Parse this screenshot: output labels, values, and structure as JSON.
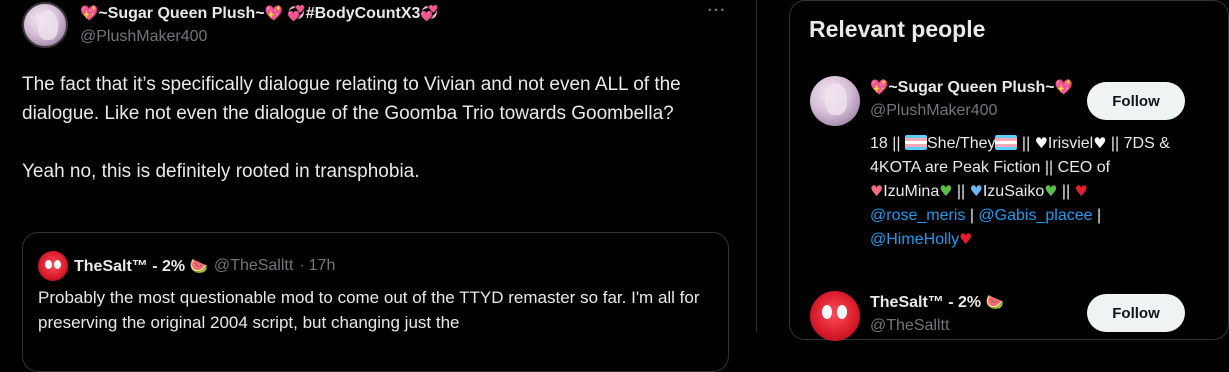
{
  "post": {
    "display_name": "~Sugar Queen Plush~",
    "display_name_suffix": "#BodyCountX3",
    "handle": "@PlushMaker400",
    "more_label": "···",
    "text": "The fact that it’s specifically dialogue relating to Vivian and not even ALL of the dialogue. Like not even the dialogue of the Goomba Trio towards Goombella?\n\nYeah no, this is definitely rooted in transphobia."
  },
  "quote": {
    "name": "TheSalt™ - 2%",
    "handle": "@TheSalltt",
    "separator": "·",
    "time": "17h",
    "text": "Probably the most questionable mod to come out of the TTYD remaster so far. I'm all for preserving the original 2004 script, but changing just the"
  },
  "sidebar": {
    "title": "Relevant people",
    "people": [
      {
        "name": "~Sugar Queen Plush~",
        "handle": "@PlushMaker400",
        "follow_label": "Follow",
        "bio": {
          "p1": "18 || ",
          "p2": "She/They",
          "p3": " || ",
          "p4": "Irisviel",
          "p5": " || 7DS & 4KOTA are Peak Fiction || CEO of ",
          "p6": "IzuMina",
          "p7": " || ",
          "p8": "IzuSaiko",
          "p9": " || ",
          "m1": "@rose_meris",
          "p10": " | ",
          "m2": "@Gabis_placee",
          "p11": " | ",
          "m3": "@HimeHolly"
        }
      },
      {
        "name": "TheSalt™ - 2%",
        "handle": "@TheSalltt",
        "follow_label": "Follow"
      }
    ]
  },
  "icons": {
    "sparkle_heart": "sparkle-heart",
    "revolving_hearts": "revolving-hearts",
    "watermelon": "watermelon",
    "trans_flag": "transgender-flag"
  }
}
